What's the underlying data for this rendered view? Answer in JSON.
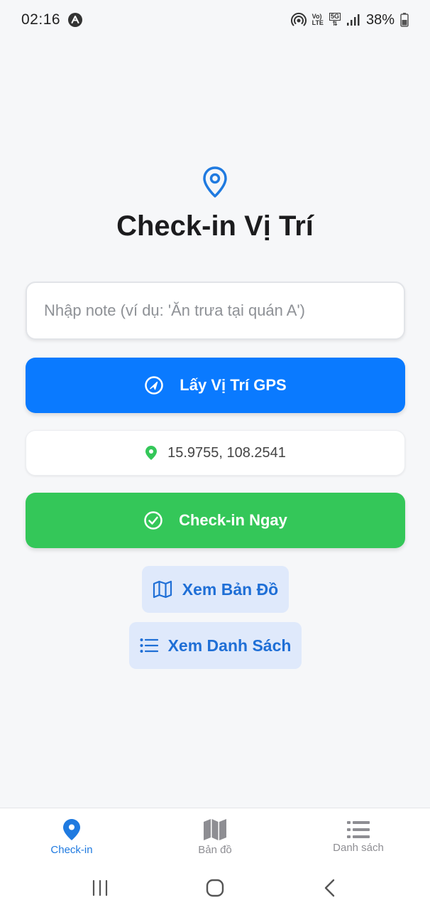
{
  "status_bar": {
    "time": "02:16",
    "battery": "38%",
    "volte_top": "Vo)",
    "volte_bottom": "LTE",
    "net_label": "5G"
  },
  "header": {
    "title": "Check-in Vị Trí",
    "icon": "map-pin-icon"
  },
  "note_input": {
    "placeholder": "Nhập note (ví dụ: 'Ăn trưa tại quán A')",
    "value": ""
  },
  "gps_button": {
    "label": "Lấy Vị Trí GPS",
    "icon": "navigation-arrow-icon"
  },
  "coordinates": {
    "text": "15.9755, 108.2541",
    "icon": "location-pin-icon"
  },
  "checkin_button": {
    "label": "Check-in Ngay",
    "icon": "check-circle-icon"
  },
  "map_button": {
    "label": "Xem Bản Đồ",
    "icon": "map-icon"
  },
  "list_button": {
    "label": "Xem Danh Sách",
    "icon": "list-icon"
  },
  "tabs": [
    {
      "label": "Check-in",
      "icon": "map-pin-icon",
      "active": true
    },
    {
      "label": "Bản đồ",
      "icon": "map-icon",
      "active": false
    },
    {
      "label": "Danh sách",
      "icon": "list-icon",
      "active": false
    }
  ],
  "colors": {
    "primary_blue": "#0a7aff",
    "success_green": "#34c759",
    "secondary_bg": "#dfe9fb",
    "secondary_text": "#1f6fd6",
    "active_tab": "#1f7ae0",
    "inactive_tab": "#8e8e93"
  }
}
